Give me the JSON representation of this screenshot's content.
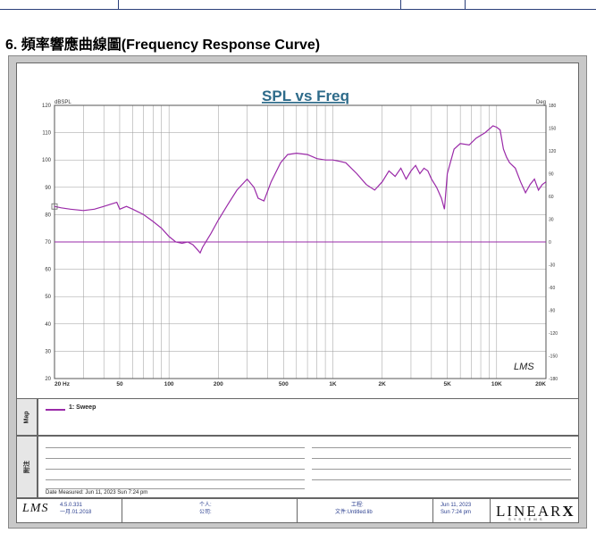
{
  "heading": "6. 頻率響應曲線圖(Frequency Response Curve)",
  "chart_data": {
    "type": "line",
    "title": "SPL vs Freq",
    "ylabel_left": "dBSPL",
    "ylabel_right": "Deg",
    "x_scale": "log",
    "xlim": [
      20,
      20000
    ],
    "ylim": [
      20,
      120
    ],
    "y2lim": [
      -180,
      180
    ],
    "x_ticks": [
      {
        "v": 20,
        "label": "20 Hz"
      },
      {
        "v": 50,
        "label": "50"
      },
      {
        "v": 100,
        "label": "100"
      },
      {
        "v": 200,
        "label": "200"
      },
      {
        "v": 500,
        "label": "500"
      },
      {
        "v": 1000,
        "label": "1K"
      },
      {
        "v": 2000,
        "label": "2K"
      },
      {
        "v": 5000,
        "label": "5K"
      },
      {
        "v": 10000,
        "label": "10K"
      },
      {
        "v": 20000,
        "label": "20K"
      }
    ],
    "y_ticks": [
      20,
      30,
      40,
      50,
      60,
      70,
      80,
      90,
      100,
      110,
      120
    ],
    "y2_ticks": [
      -180,
      -150,
      -120,
      -90,
      -60,
      -30,
      0,
      30,
      60,
      90,
      120,
      150,
      180
    ],
    "grid": true,
    "series": [
      {
        "name": "1: Sweep",
        "color": "#9a2aa8",
        "points": [
          [
            20,
            83
          ],
          [
            22,
            82.5
          ],
          [
            25,
            82
          ],
          [
            30,
            81.5
          ],
          [
            35,
            82
          ],
          [
            40,
            83
          ],
          [
            45,
            84
          ],
          [
            48,
            84.5
          ],
          [
            50,
            82
          ],
          [
            55,
            83
          ],
          [
            60,
            82
          ],
          [
            70,
            80
          ],
          [
            80,
            77.5
          ],
          [
            90,
            75
          ],
          [
            100,
            72
          ],
          [
            110,
            70
          ],
          [
            120,
            69.5
          ],
          [
            130,
            70
          ],
          [
            140,
            69
          ],
          [
            150,
            67
          ],
          [
            155,
            66
          ],
          [
            160,
            68
          ],
          [
            180,
            73
          ],
          [
            200,
            78
          ],
          [
            230,
            84
          ],
          [
            260,
            89
          ],
          [
            300,
            93
          ],
          [
            330,
            90
          ],
          [
            350,
            86
          ],
          [
            380,
            85
          ],
          [
            420,
            92
          ],
          [
            480,
            99
          ],
          [
            530,
            102
          ],
          [
            600,
            102.5
          ],
          [
            700,
            102
          ],
          [
            800,
            100.5
          ],
          [
            900,
            100
          ],
          [
            1000,
            100
          ],
          [
            1100,
            99.5
          ],
          [
            1200,
            99
          ],
          [
            1400,
            95
          ],
          [
            1600,
            91
          ],
          [
            1800,
            89
          ],
          [
            2000,
            92
          ],
          [
            2200,
            96
          ],
          [
            2400,
            94
          ],
          [
            2600,
            97
          ],
          [
            2800,
            93
          ],
          [
            3000,
            96
          ],
          [
            3200,
            98
          ],
          [
            3400,
            95
          ],
          [
            3600,
            97
          ],
          [
            3800,
            96
          ],
          [
            4000,
            93
          ],
          [
            4300,
            90
          ],
          [
            4600,
            86
          ],
          [
            4800,
            82
          ],
          [
            5000,
            95
          ],
          [
            5500,
            104
          ],
          [
            6000,
            106
          ],
          [
            6800,
            105.5
          ],
          [
            7500,
            108
          ],
          [
            8500,
            110
          ],
          [
            9500,
            112.5
          ],
          [
            10000,
            112
          ],
          [
            10500,
            111
          ],
          [
            11000,
            104
          ],
          [
            11500,
            101
          ],
          [
            12000,
            99
          ],
          [
            13000,
            97
          ],
          [
            14000,
            92
          ],
          [
            15000,
            88
          ],
          [
            16000,
            91
          ],
          [
            17000,
            93
          ],
          [
            18000,
            89
          ],
          [
            19000,
            91
          ],
          [
            20000,
            92
          ]
        ],
        "phase_reference_deg": 0
      }
    ]
  },
  "legend_label": "1: Sweep",
  "sidebar": {
    "map": "Map",
    "notes": "附注"
  },
  "date_measured": "Date Measured: Jun 11, 2023  Sun  7:24 pm",
  "footer": {
    "version": "4.5.0.331",
    "version_date": "一月.01.2018",
    "person_label": "个人:",
    "company_label": "公司:",
    "project_label": "工程:",
    "file_label": "文件:Untitled.lib",
    "date": "Jun 11, 2023",
    "time": "Sun  7:24 pm",
    "brand": "LINEAR",
    "brand_x": "X",
    "brand_sub": "S Y S T E M S",
    "logo": "LMS"
  },
  "watermark": "LMS",
  "colors": {
    "curve": "#9a2aa8",
    "title": "#2e6b8a",
    "frame": "#c8c8c8"
  }
}
